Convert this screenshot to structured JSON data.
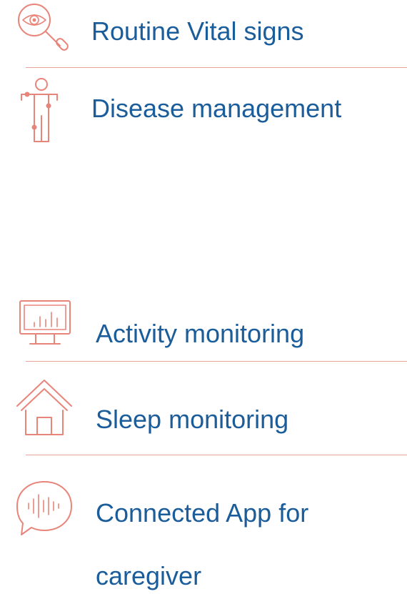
{
  "features": {
    "vital_signs": {
      "label": "Routine Vital signs",
      "icon": "eye-magnifier-icon"
    },
    "disease": {
      "label": "Disease management",
      "icon": "body-figure-icon"
    },
    "activity": {
      "label": "Activity monitoring",
      "icon": "monitor-chart-icon"
    },
    "sleep": {
      "label": "Sleep monitoring",
      "icon": "house-icon"
    },
    "app": {
      "label_line1": "Connected App for",
      "label_line2": "caregiver",
      "icon": "voice-bubble-icon"
    }
  },
  "colors": {
    "text": "#1b5d9a",
    "accent": "#e8857b",
    "divider": "#e8a49c"
  }
}
